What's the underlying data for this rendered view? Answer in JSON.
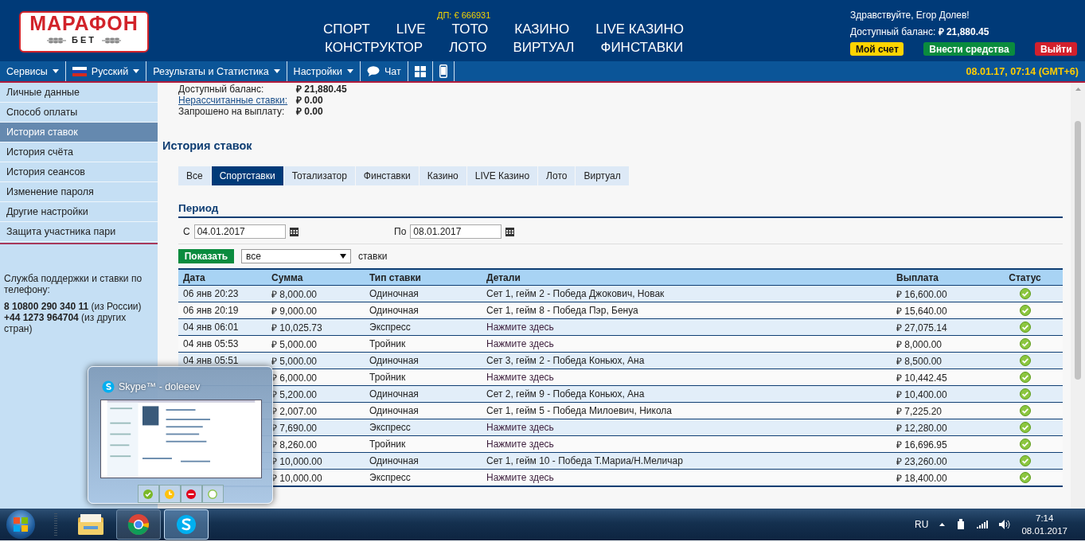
{
  "header": {
    "logo": {
      "title": "МАРАФОН",
      "subtitle": "БЕТ"
    },
    "promo": "ДП: € 666931",
    "nav_rows": [
      [
        "СПОРТ",
        "LIVE",
        "ТОТО",
        "КАЗИНО",
        "LIVE КАЗИНО"
      ],
      [
        "КОНСТРУКТОР",
        "ЛОТО",
        "ВИРТУАЛ",
        "ФИНСТАВКИ"
      ]
    ],
    "greeting": "Здравствуйте, Егор Долев!",
    "balance": "Доступный баланс: **₽ 21,880.45**",
    "buttons": [
      {
        "label": "Мой счет",
        "kind": "account"
      },
      {
        "label": "Внести средства",
        "kind": "deposit"
      },
      {
        "label": "Выйти",
        "kind": "logout"
      }
    ]
  },
  "menu_bar": {
    "items": [
      {
        "label": "Сервисы",
        "kind": "dropdown"
      },
      {
        "label": "Русский",
        "kind": "language"
      },
      {
        "label": "Результаты и Статистика",
        "kind": "dropdown"
      },
      {
        "label": "Настройки",
        "kind": "dropdown"
      },
      {
        "label": "Чат",
        "kind": "chat"
      },
      {
        "kind": "windows"
      },
      {
        "kind": "mobile"
      }
    ],
    "datetime": "08.01.17, 07:14 (GMT+6)"
  },
  "sidebar": {
    "items": [
      {
        "label": "Личные данные",
        "selected": false
      },
      {
        "label": "Способ оплаты",
        "selected": false
      },
      {
        "label": "История ставок",
        "selected": true
      },
      {
        "label": "История счёта",
        "selected": false
      },
      {
        "label": "История сеансов",
        "selected": false
      },
      {
        "label": "Изменение пароля",
        "selected": false
      },
      {
        "label": "Другие настройки",
        "selected": false
      },
      {
        "label": "Защита участника пари",
        "selected": false
      }
    ],
    "support": {
      "text": "Служба поддержки и ставки по телефону:",
      "phones": [
        "**8 10800 290 340 11** (из России)",
        "**+44 1273 964704** (из других стран)"
      ]
    }
  },
  "account_summary": [
    {
      "label": "Доступный баланс:",
      "value": "₽ 21,880.45",
      "kind": "text"
    },
    {
      "label": "Нерассчитанные ставки:",
      "value": "₽ 0.00",
      "kind": "link"
    },
    {
      "label": "Запрошено на выплату:",
      "value": "₽ 0.00",
      "kind": "text"
    }
  ],
  "page_title": "История ставок",
  "tabs": [
    {
      "label": "Все",
      "selected": false
    },
    {
      "label": "Спортставки",
      "selected": true
    },
    {
      "label": "Тотализатор",
      "selected": false
    },
    {
      "label": "Финставки",
      "selected": false
    },
    {
      "label": "Казино",
      "selected": false
    },
    {
      "label": "LIVE Казино",
      "selected": false
    },
    {
      "label": "Лото",
      "selected": false
    },
    {
      "label": "Виртуал",
      "selected": false
    }
  ],
  "period": {
    "title": "Период",
    "from_label": "С",
    "from_value": "04.01.2017",
    "to_label": "По",
    "to_value": "08.01.2017"
  },
  "filter": {
    "button": "Показать",
    "select_value": "все",
    "suffix": "ставки"
  },
  "table": {
    "columns": [
      "Дата",
      "Сумма",
      "Тип ставки",
      "Детали",
      "Выплата",
      "Статус"
    ],
    "rows": [
      {
        "date": "06 янв 20:23",
        "sum": "₽ 8,000.00",
        "type": "Одиночная",
        "details": "Сет 1, гейм 2 - Победа Джокович, Новак",
        "details_link": false,
        "payout": "₽ 16,600.00",
        "won": true
      },
      {
        "date": "06 янв 20:19",
        "sum": "₽ 9,000.00",
        "type": "Одиночная",
        "details": "Сет 1, гейм 8 - Победа Пэр, Бенуа",
        "details_link": false,
        "payout": "₽ 15,640.00",
        "won": true
      },
      {
        "date": "04 янв 06:01",
        "sum": "₽ 10,025.73",
        "type": "Экспресс",
        "details": "Нажмите здесь",
        "details_link": true,
        "payout": "₽ 27,075.14",
        "won": true
      },
      {
        "date": "04 янв 05:53",
        "sum": "₽ 5,000.00",
        "type": "Тройник",
        "details": "Нажмите здесь",
        "details_link": true,
        "payout": "₽ 8,000.00",
        "won": true
      },
      {
        "date": "04 янв 05:51",
        "sum": "₽ 5,000.00",
        "type": "Одиночная",
        "details": "Сет 3, гейм 2 - Победа Коньюх, Ана",
        "details_link": false,
        "payout": "₽ 8,500.00",
        "won": true
      },
      {
        "sum": "₽ 6,000.00",
        "type": "Тройник",
        "details": "Нажмите здесь",
        "details_link": true,
        "payout": "₽ 10,442.45",
        "won": true
      },
      {
        "sum": "₽ 5,200.00",
        "type": "Одиночная",
        "details": "Сет 2, гейм 9 - Победа Коньюх, Ана",
        "details_link": false,
        "payout": "₽ 10,400.00",
        "won": true
      },
      {
        "sum": "₽ 2,007.00",
        "type": "Одиночная",
        "details": "Сет 1, гейм 5 - Победа Милоевич, Никола",
        "details_link": false,
        "payout": "₽ 7,225.20",
        "won": true
      },
      {
        "sum": "₽ 7,690.00",
        "type": "Экспресс",
        "details": "Нажмите здесь",
        "details_link": true,
        "payout": "₽ 12,280.00",
        "won": true
      },
      {
        "sum": "₽ 8,260.00",
        "type": "Тройник",
        "details": "Нажмите здесь",
        "details_link": true,
        "payout": "₽ 16,696.95",
        "won": true
      },
      {
        "sum": "₽ 10,000.00",
        "type": "Одиночная",
        "details": "Сет 1, гейм 10 - Победа Т.Мариа/Н.Меличар",
        "details_link": false,
        "payout": "₽ 23,260.00",
        "won": true
      },
      {
        "sum": "₽ 10,000.00",
        "type": "Экспресс",
        "details": "Нажмите здесь",
        "details_link": true,
        "payout": "₽ 18,400.00",
        "won": true
      }
    ]
  },
  "skype_preview": {
    "title": "Skype™ - doleeev",
    "buttons": [
      {
        "kind": "online"
      },
      {
        "kind": "away"
      },
      {
        "kind": "busy"
      },
      {
        "kind": "invisible"
      }
    ]
  },
  "taskbar": {
    "apps": [
      {
        "kind": "explorer",
        "running": false,
        "selected": false
      },
      {
        "kind": "browser",
        "running": true,
        "selected": false
      },
      {
        "kind": "skype",
        "running": true,
        "selected": true
      }
    ],
    "language": "RU",
    "time": "7:14",
    "date": "08.01.2017"
  }
}
